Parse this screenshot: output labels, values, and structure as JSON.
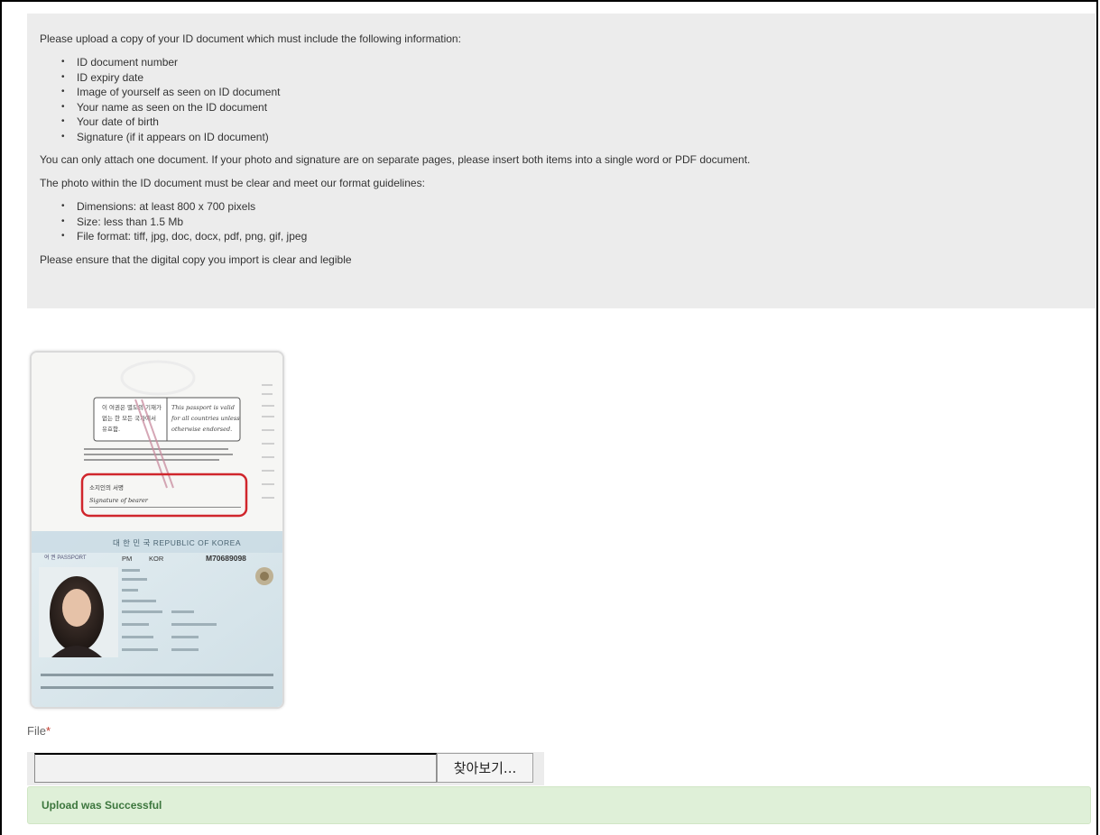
{
  "instructions": {
    "intro": "Please upload a copy of your ID document which must include the following information:",
    "required_items": [
      "ID document number",
      "ID expiry date",
      "Image of yourself as seen on ID document",
      "Your name as seen on the ID document",
      "Your date of birth",
      "Signature (if it appears on ID document)"
    ],
    "single_doc_note": "You can only attach one document. If your photo and signature are on separate pages, please insert both items into a single word or PDF document.",
    "photo_note": "The photo within the ID document must be clear and meet our format guidelines:",
    "format_items": [
      "Dimensions: at least 800 x 700 pixels",
      "Size: less than 1.5 Mb",
      "File format: tiff, jpg, doc, docx, pdf, png, gif, jpeg"
    ],
    "legibility_note": "Please ensure that the digital copy you import is clear and legible"
  },
  "passport_sample": {
    "ko_validity": "이 여권은 별도의 기재가 없는 한 모든 국가에서 유효함.",
    "en_validity": "This passport is valid for all countries unless otherwise endorsed.",
    "signature_ko": "소지인의 서명",
    "signature_en": "Signature of bearer",
    "country_line": "대 한 민 국   REPUBLIC OF KOREA",
    "doc_label": "여 권  PASSPORT",
    "type": "PM",
    "country_code": "KOR",
    "passport_number": "M70689098"
  },
  "upload": {
    "label": "File",
    "required_mark": "*",
    "browse_label": "찾아보기...",
    "file_value": "",
    "status_message": "Upload was Successful"
  },
  "colors": {
    "panel_bg": "#ececec",
    "success_bg": "#dff0d8",
    "success_text": "#3c763d",
    "signature_box": "#d0262c",
    "required_mark": "#c0392b"
  }
}
